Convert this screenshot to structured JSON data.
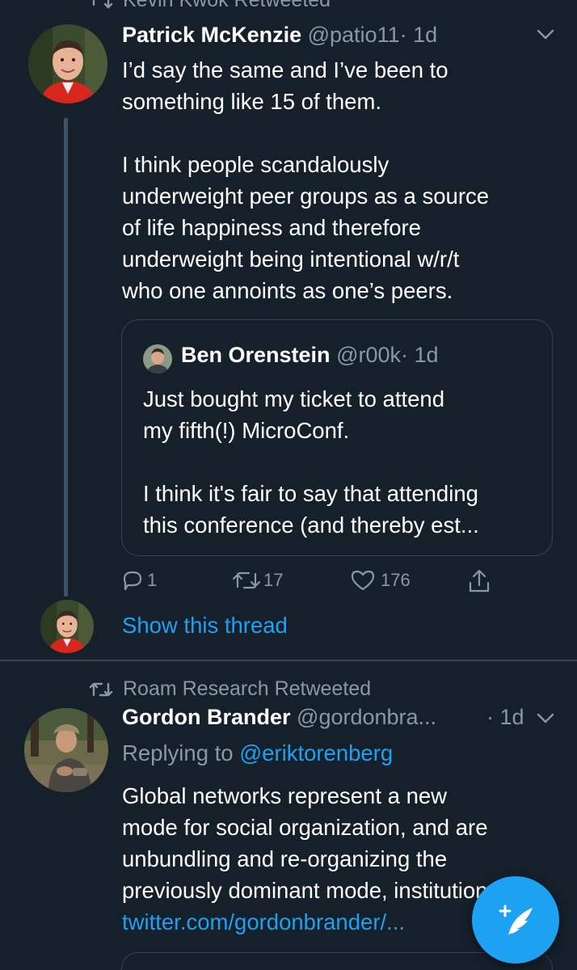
{
  "tweet1": {
    "retweeted_by": "Kevin Kwok Retweeted",
    "author_name": "Patrick McKenzie",
    "author_handle": "@patio11",
    "time": "· 1d",
    "text_lines_p1": [
      "I’d say the same and I’ve been to",
      "something like 15 of them."
    ],
    "text_lines_p2": [
      "I think people scandalously",
      "underweight peer groups as a source",
      "of life happiness and therefore",
      "underweight being intentional w/r/t",
      "who one annoints as one’s peers."
    ],
    "quote": {
      "author_name": "Ben Orenstein",
      "author_handle": "@r00k",
      "time": "· 1d",
      "text_lines_p1": [
        "Just bought my ticket to attend",
        "my fifth(!) MicroConf."
      ],
      "text_lines_p2": [
        "I think it's fair to say that attending",
        "this conference (and thereby est..."
      ]
    },
    "actions": {
      "reply_count": "1",
      "retweet_count": "17",
      "like_count": "176"
    },
    "show_thread_label": "Show this thread"
  },
  "tweet2": {
    "retweeted_by": "Roam Research Retweeted",
    "author_name": "Gordon Brander",
    "author_handle": "@gordonbra...",
    "time": "· 1d",
    "replying_to_prefix": "Replying to",
    "replying_to_handle": "@eriktorenberg",
    "text_lines": [
      "Global networks represent a new",
      "mode for social organization, and are",
      "unbundling and re-organizing the",
      "previously dominant mode, institutions"
    ],
    "link": "twitter.com/gordonbrander/..."
  },
  "fab": {
    "icon": "compose-tweet-icon"
  },
  "colors": {
    "background": "#15202b",
    "accent": "#1da1f2",
    "secondary_text": "#8899a6",
    "border": "#38444d"
  }
}
